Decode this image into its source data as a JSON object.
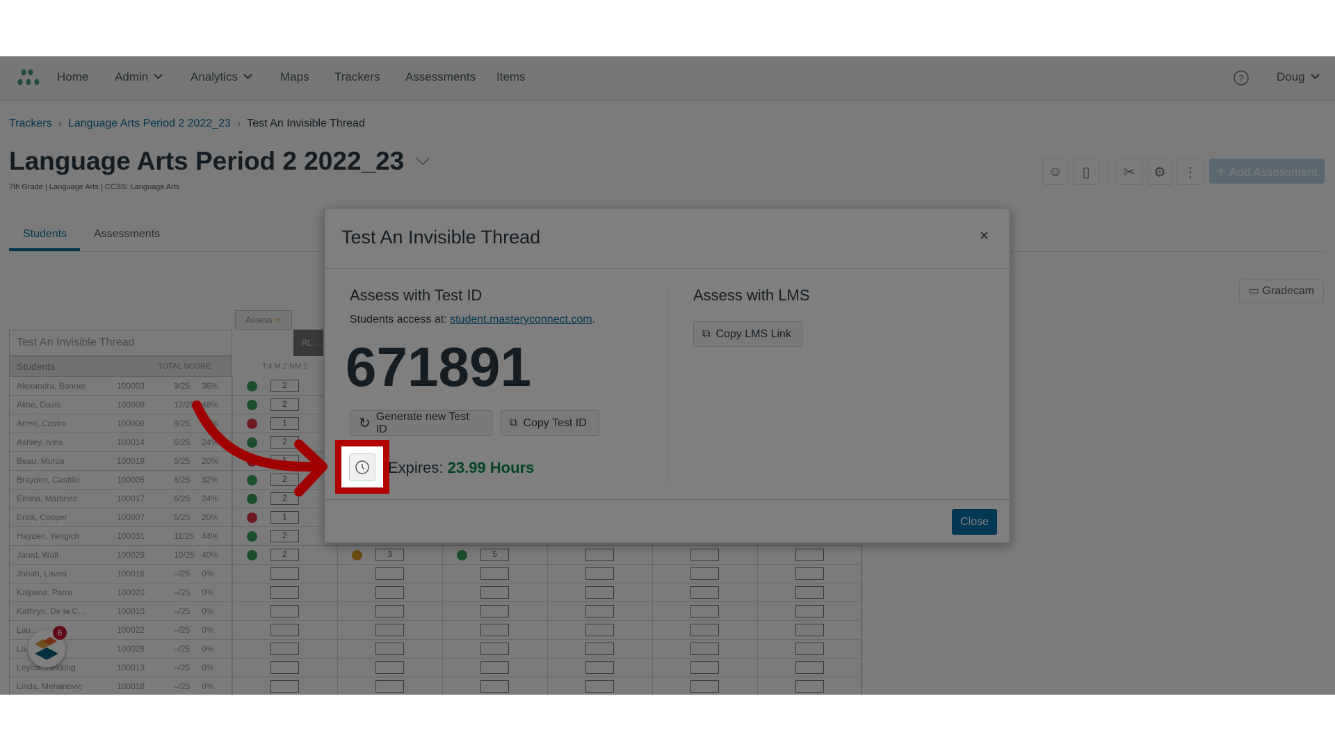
{
  "nav": {
    "items": [
      {
        "label": "Home"
      },
      {
        "label": "Admin",
        "dropdown": true
      },
      {
        "label": "Analytics",
        "dropdown": true
      },
      {
        "label": "Maps"
      },
      {
        "label": "Trackers"
      },
      {
        "label": "Assessments"
      },
      {
        "label": "Items"
      }
    ],
    "user": "Doug",
    "help_icon": "help-circle-icon"
  },
  "breadcrumb": [
    "Trackers",
    "Language Arts Period 2 2022_23",
    "Test An Invisible Thread"
  ],
  "page": {
    "title": "Language Arts Period 2 2022_23",
    "subtitle": "7th Grade | Language Arts | CCSS: Language Arts",
    "add_button": "Add Assessment",
    "gradecam": "Gradecam",
    "tabs": [
      "Students",
      "Assessments"
    ],
    "active_tab": "Students"
  },
  "table": {
    "title": "Test An Invisible Thread",
    "assess_tab": "Assess",
    "col_header": "RL....",
    "headers": {
      "students": "Students",
      "total": "TOTAL SCORE",
      "standard": "T:4  M:2  NM:2"
    },
    "rows": [
      {
        "name": "Alexandra, Bonner",
        "id": "100003",
        "score": "9/25",
        "pct": "36%",
        "mark": "2",
        "status": "green"
      },
      {
        "name": "Aline, Davis",
        "id": "100009",
        "score": "12/25",
        "pct": "48%",
        "mark": "2",
        "status": "green"
      },
      {
        "name": "Arren, Castro",
        "id": "100006",
        "score": "9/25",
        "pct": "36%",
        "mark": "1",
        "status": "red"
      },
      {
        "name": "Ashley, Ivins",
        "id": "100014",
        "score": "6/25",
        "pct": "24%",
        "mark": "2",
        "status": "green"
      },
      {
        "name": "Beau, Murua",
        "id": "100019",
        "score": "5/25",
        "pct": "20%",
        "mark": "1",
        "status": "red"
      },
      {
        "name": "Brayden, Castillo",
        "id": "100005",
        "score": "8/25",
        "pct": "32%",
        "mark": "2",
        "status": "green"
      },
      {
        "name": "Emina, Martinez",
        "id": "100017",
        "score": "6/25",
        "pct": "24%",
        "mark": "2",
        "status": "green"
      },
      {
        "name": "Erick, Cooper",
        "id": "100007",
        "score": "5/25",
        "pct": "20%",
        "mark": "1",
        "status": "red"
      },
      {
        "name": "Hayden, Yengich",
        "id": "100031",
        "score": "11/25",
        "pct": "44%",
        "mark": "2",
        "status": "green"
      },
      {
        "name": "Jared, Wall",
        "id": "100029",
        "score": "10/25",
        "pct": "40%",
        "mark": "2",
        "status": "green",
        "extra": [
          {
            "mark": "3",
            "status": "orange"
          },
          {
            "mark": "5",
            "status": "green"
          }
        ]
      },
      {
        "name": "Jonah, Lavea",
        "id": "100016",
        "score": "–/25",
        "pct": "0%"
      },
      {
        "name": "Kalpana, Parra",
        "id": "100020",
        "score": "–/25",
        "pct": "0%"
      },
      {
        "name": "Kathryn, De la C…",
        "id": "100010",
        "score": "–/25",
        "pct": "0%"
      },
      {
        "name": "Lau…",
        "id": "100022",
        "score": "–/25",
        "pct": "0%"
      },
      {
        "name": "La…",
        "id": "100028",
        "score": "–/25",
        "pct": "0%"
      },
      {
        "name": "Leycia, Hekking",
        "id": "100013",
        "score": "–/25",
        "pct": "0%"
      },
      {
        "name": "Linda, Mehanovic",
        "id": "100018",
        "score": "–/25",
        "pct": "0%"
      }
    ]
  },
  "modal": {
    "title": "Test An Invisible Thread",
    "left_heading": "Assess with Test ID",
    "access_label": "Students access at:",
    "access_link": "student.masteryconnect.com",
    "test_id": "671891",
    "generate_button": "Generate new Test ID",
    "copy_button": "Copy Test ID",
    "expires_label": "Expires:",
    "expires_value": "23.99 Hours",
    "right_heading": "Assess with LMS",
    "copy_lms_button": "Copy LMS Link",
    "close_button": "Close",
    "close_x": "×"
  },
  "chat_badge": "6",
  "colors": {
    "accent": "#0770a3",
    "expires": "#0b874b",
    "highlight": "#b00000",
    "green": "#3aa35a",
    "red": "#e0394a",
    "orange": "#e39b2c"
  }
}
